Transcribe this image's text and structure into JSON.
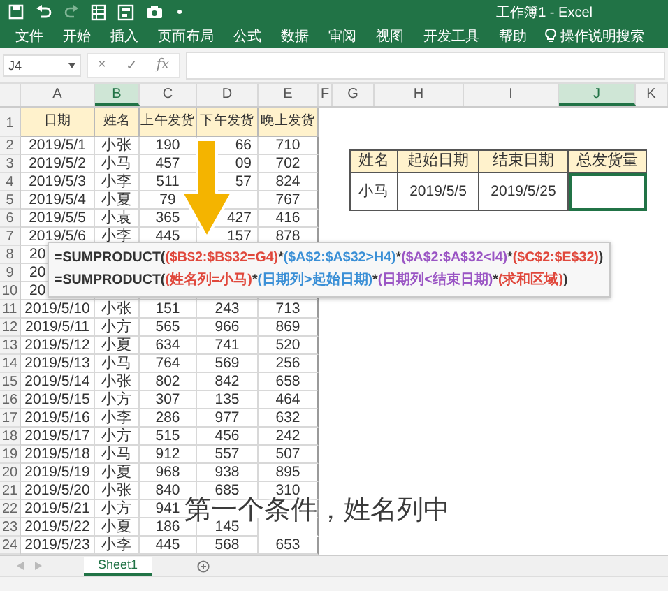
{
  "window": {
    "title": "工作簿1 - Excel"
  },
  "ribbon": {
    "tabs": [
      {
        "label": "文件",
        "selected": false
      },
      {
        "label": "开始",
        "selected": false
      },
      {
        "label": "插入",
        "selected": false
      },
      {
        "label": "页面布局",
        "selected": false
      },
      {
        "label": "公式",
        "selected": false
      },
      {
        "label": "数据",
        "selected": false
      },
      {
        "label": "审阅",
        "selected": false
      },
      {
        "label": "视图",
        "selected": false
      },
      {
        "label": "开发工具",
        "selected": false
      },
      {
        "label": "帮助",
        "selected": false
      }
    ],
    "search": {
      "placeholder": "操作说明搜索"
    }
  },
  "formula_bar": {
    "name_box": "J4",
    "buttons": [
      "×",
      "✓",
      "fx"
    ]
  },
  "sheet": {
    "columns": [
      {
        "label": "A",
        "selected": false
      },
      {
        "label": "B",
        "selected": true
      },
      {
        "label": "C",
        "selected": false
      },
      {
        "label": "D",
        "selected": false
      },
      {
        "label": "E",
        "selected": false
      },
      {
        "label": "F",
        "selected": false
      },
      {
        "label": "G",
        "selected": false
      },
      {
        "label": "H",
        "selected": false
      },
      {
        "label": "I",
        "selected": false
      },
      {
        "label": "J",
        "selected": true
      },
      {
        "label": "K",
        "selected": false
      }
    ],
    "header_row": {
      "number": "1",
      "cells": [
        "日期",
        "姓名",
        "上午发货",
        "下午发货",
        "晚上发货"
      ]
    },
    "rows": [
      {
        "number": "2",
        "kind": "full",
        "cells": [
          "2019/5/1",
          "小张",
          "190",
          "66",
          "710"
        ]
      },
      {
        "number": "3",
        "kind": "full",
        "cells": [
          "2019/5/2",
          "小马",
          "457",
          "09",
          "702"
        ]
      },
      {
        "number": "4",
        "kind": "full",
        "cells": [
          "2019/5/3",
          "小李",
          "511",
          "57",
          "824"
        ]
      },
      {
        "number": "5",
        "kind": "full",
        "cells": [
          "2019/5/4",
          "小夏",
          "79",
          "",
          "767"
        ]
      },
      {
        "number": "6",
        "kind": "full",
        "cells": [
          "2019/5/5",
          "小袁",
          "365",
          "427",
          "416"
        ]
      },
      {
        "number": "7",
        "kind": "full",
        "cells": [
          "2019/5/6",
          "小李",
          "445",
          "157",
          "878"
        ]
      },
      {
        "number": "8",
        "kind": "covered",
        "cells": [
          "20"
        ]
      },
      {
        "number": "9",
        "kind": "covered",
        "cells": [
          "20"
        ]
      },
      {
        "number": "10",
        "kind": "covered",
        "cells": [
          "20"
        ]
      },
      {
        "number": "11",
        "kind": "full",
        "cells": [
          "2019/5/10",
          "小张",
          "151",
          "243",
          "713"
        ]
      },
      {
        "number": "12",
        "kind": "full",
        "cells": [
          "2019/5/11",
          "小方",
          "565",
          "966",
          "869"
        ]
      },
      {
        "number": "13",
        "kind": "full",
        "cells": [
          "2019/5/12",
          "小夏",
          "634",
          "741",
          "520"
        ]
      },
      {
        "number": "14",
        "kind": "full",
        "cells": [
          "2019/5/13",
          "小马",
          "764",
          "569",
          "256"
        ]
      },
      {
        "number": "15",
        "kind": "full",
        "cells": [
          "2019/5/14",
          "小张",
          "802",
          "842",
          "658"
        ]
      },
      {
        "number": "16",
        "kind": "full",
        "cells": [
          "2019/5/15",
          "小方",
          "307",
          "135",
          "464"
        ]
      },
      {
        "number": "17",
        "kind": "full",
        "cells": [
          "2019/5/16",
          "小李",
          "286",
          "977",
          "632"
        ]
      },
      {
        "number": "18",
        "kind": "full",
        "cells": [
          "2019/5/17",
          "小方",
          "515",
          "456",
          "242"
        ]
      },
      {
        "number": "19",
        "kind": "full",
        "cells": [
          "2019/5/18",
          "小马",
          "912",
          "557",
          "507"
        ]
      },
      {
        "number": "20",
        "kind": "full",
        "cells": [
          "2019/5/19",
          "小夏",
          "968",
          "938",
          "895"
        ]
      },
      {
        "number": "21",
        "kind": "full",
        "cells": [
          "2019/5/20",
          "小张",
          "840",
          "685",
          "310"
        ]
      },
      {
        "number": "22",
        "kind": "captioned",
        "cells": [
          "2019/5/21",
          "小方",
          "941",
          "",
          ""
        ]
      },
      {
        "number": "23",
        "kind": "captioned",
        "cells": [
          "2019/5/22",
          "小夏",
          "186",
          "145",
          ""
        ]
      },
      {
        "number": "24",
        "kind": "full",
        "cells": [
          "2019/5/23",
          "小李",
          "445",
          "568",
          "653"
        ]
      }
    ],
    "lookup_table": {
      "headers": [
        "姓名",
        "起始日期",
        "结束日期",
        "总发货量"
      ],
      "cells": [
        {
          "text": "小马",
          "selected": false
        },
        {
          "text": "2019/5/5",
          "selected": false
        },
        {
          "text": "2019/5/25",
          "selected": false
        },
        {
          "selected": true
        }
      ]
    }
  },
  "formula_tooltip": {
    "lines": [
      [
        {
          "text": "=SUMPRODUCT(",
          "color": "#333333"
        },
        {
          "text": "($B$2:$B$32=G4)",
          "color": "#e0483c"
        },
        {
          "text": "*",
          "color": "#333333"
        },
        {
          "text": "($A$2:$A$32>H4)",
          "color": "#3a8fd6"
        },
        {
          "text": "*",
          "color": "#333333"
        },
        {
          "text": "($A$2:$A$32<I4)",
          "color": "#9a55c4"
        },
        {
          "text": "*",
          "color": "#333333"
        },
        {
          "text": "($C$2:$E$32)",
          "color": "#e0483c"
        },
        {
          "text": ")",
          "color": "#333333"
        }
      ],
      [
        {
          "text": "=SUMPRODUCT(",
          "color": "#333333"
        },
        {
          "text": "(姓名列=小马)",
          "color": "#e0483c"
        },
        {
          "text": "*",
          "color": "#333333"
        },
        {
          "text": "(日期列>起始日期)",
          "color": "#3a8fd6"
        },
        {
          "text": "*",
          "color": "#333333"
        },
        {
          "text": "(日期列<结束日期)",
          "color": "#9a55c4"
        },
        {
          "text": "*",
          "color": "#333333"
        },
        {
          "text": "(求和区域)",
          "color": "#e0483c"
        },
        {
          "text": ")",
          "color": "#333333"
        }
      ]
    ]
  },
  "subtitle": "第一个条件，姓名列中",
  "sheet_tabs": [
    {
      "label": "Sheet1",
      "selected": true
    }
  ]
}
